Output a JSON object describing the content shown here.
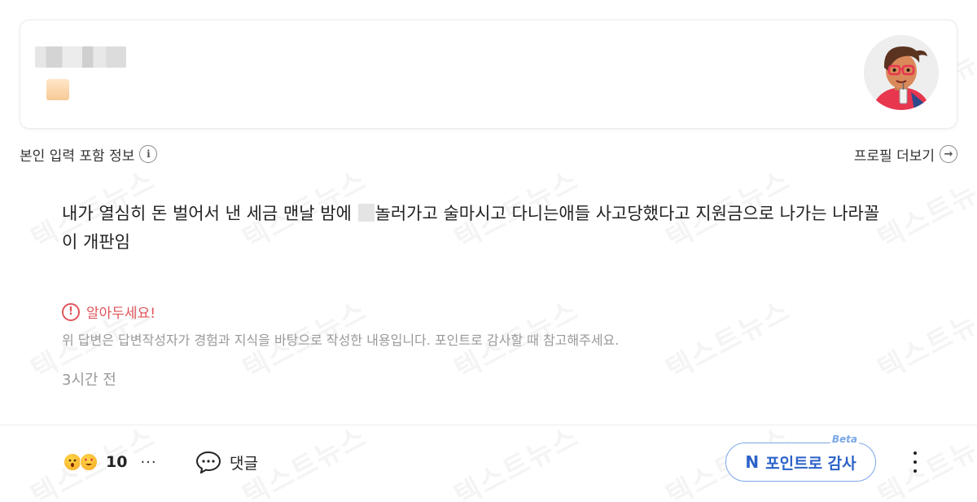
{
  "watermark": {
    "text": "텍스트뉴스"
  },
  "info_row": {
    "label": "본인 입력 포함 정보",
    "info_icon": "i",
    "profile_more": "프로필 더보기",
    "profile_more_icon": "→"
  },
  "answer": {
    "line1_before": "내가 열심히 돈 벌어서 낸 세금 맨날 밤에 ",
    "line1_after": "놀러가고 술마시고 다니는애들 사고당했다고 지원금으로 나가는 나라꼴",
    "line2": "이 개판임"
  },
  "notice": {
    "icon": "!",
    "title": "알아두세요!",
    "text": "위 답변은 답변작성자가 경험과 지식을 바탕으로 작성한 내용입니다. 포인트로 감사할 때 참고해주세요."
  },
  "time": "3시간 전",
  "footer": {
    "reaction_count": "10",
    "more": "···",
    "comment_label": "댓글",
    "thanks_icon": "N",
    "thanks_label": "포인트로 감사",
    "beta_label": "Beta"
  },
  "colors": {
    "notice": "#e0555b",
    "accent": "#2c63c9",
    "accent_border": "#7aa7e6",
    "muted": "#999999"
  }
}
